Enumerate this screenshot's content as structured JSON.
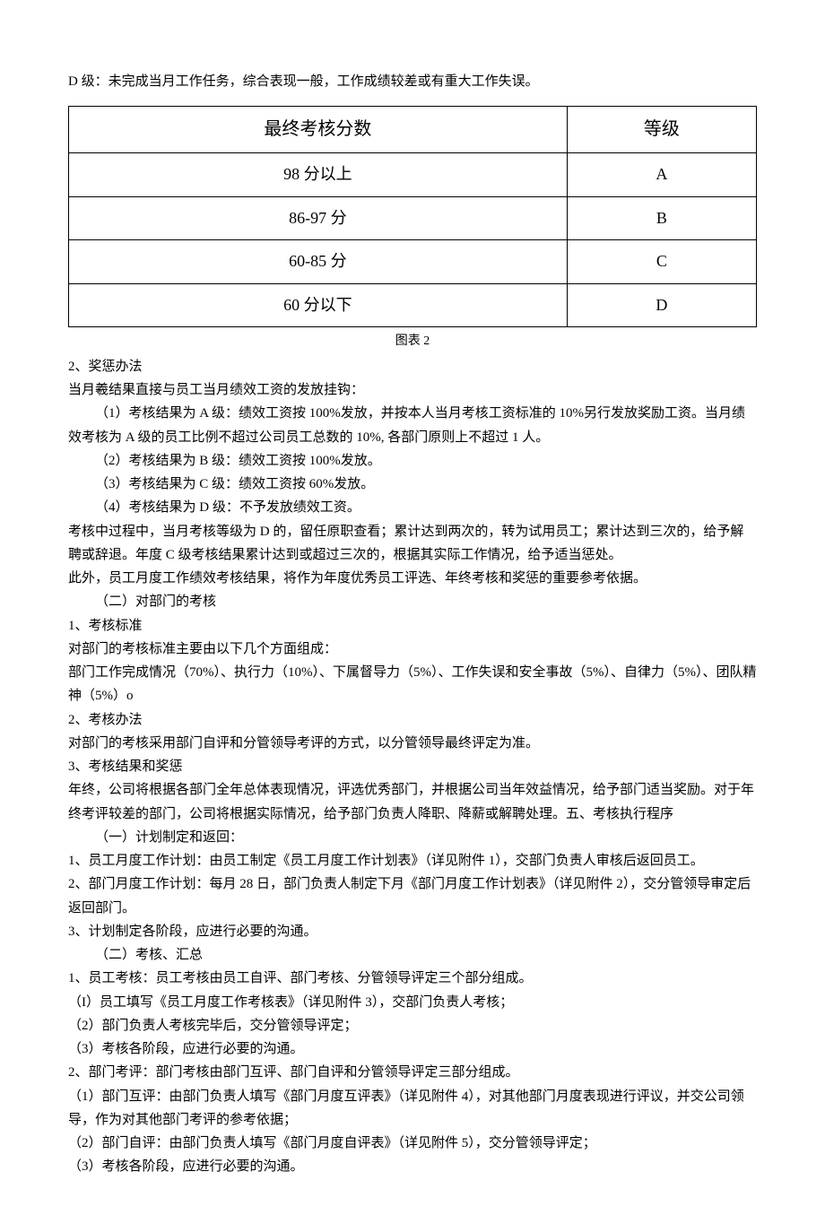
{
  "intro": "D 级：未完成当月工作任务，综合表现一般，工作成绩较差或有重大工作失误。",
  "table": {
    "header_score": "最终考核分数",
    "header_grade": "等级",
    "rows": [
      {
        "score": "98 分以上",
        "grade": "A"
      },
      {
        "score": "86-97 分",
        "grade": "B"
      },
      {
        "score": "60-85 分",
        "grade": "C"
      },
      {
        "score": "60 分以下",
        "grade": "D"
      }
    ],
    "caption": "图表 2"
  },
  "s1": {
    "h": "2、奖惩办法",
    "p0": "当月羲结果直接与员工当月绩效工资的发放挂钩：",
    "p1": "（1）考核结果为 A 级：绩效工资按 100%发放，并按本人当月考核工资标准的 10%另行发放奖励工资。当月绩效考核为 A 级的员工比例不超过公司员工总数的 10%, 各部门原则上不超过 1 人。",
    "p2": "（2）考核结果为 B 级：绩效工资按 100%发放。",
    "p3": "（3）考核结果为 C 级：绩效工资按 60%发放。",
    "p4": "（4）考核结果为 D 级：不予发放绩效工资。",
    "p5": "考核中过程中，当月考核等级为 D 的，留任原职查看；累计达到两次的，转为试用员工；累计达到三次的，给予解聘或辞退。年度 C 级考核结果累计达到或超过三次的，根据其实际工作情况，给予适当惩处。",
    "p6": "此外，员工月度工作绩效考核结果，将作为年度优秀员工评选、年终考核和奖惩的重要参考依据。"
  },
  "s2": {
    "h0": "（二）对部门的考核",
    "h1": "1、考核标准",
    "p1": "对部门的考核标准主要由以下几个方面组成：",
    "p2": "部门工作完成情况（70%）、执行力（10%）、下属督导力（5%）、工作失误和安全事故（5%）、自律力（5%）、团队精神（5%）o",
    "h2": "2、考核办法",
    "p3": "对部门的考核采用部门自评和分管领导考评的方式，以分管领导最终评定为准。",
    "h3": "3、考核结果和奖惩",
    "p4": "年终，公司将根据各部门全年总体表现情况，评选优秀部门，并根据公司当年效益情况，给予部门适当奖励。对于年终考评较差的部门，公司将根据实际情况，给予部门负责人降职、降薪或解聘处理。五、考核执行程序"
  },
  "s3": {
    "h0": "（一）计划制定和返回：",
    "p1": "1、员工月度工作计划：由员工制定《员工月度工作计划表》（详见附件 1），交部门负责人审核后返回员工。",
    "p2": "2、部门月度工作计划：每月 28 日，部门负责人制定下月《部门月度工作计划表》（详见附件 2），交分管领导审定后返回部门。",
    "p3": "3、计划制定各阶段，应进行必要的沟通。"
  },
  "s4": {
    "h0": "（二）考核、汇总",
    "p1": "1、员工考核：员工考核由员工自评、部门考核、分管领导评定三个部分组成。",
    "p2": "（I）员工填写《员工月度工作考核表》（详见附件 3），交部门负责人考核；",
    "p3": "（2）部门负责人考核完毕后，交分管领导评定；",
    "p4": "（3）考核各阶段，应进行必要的沟通。",
    "p5": "2、部门考评：部门考核由部门互评、部门自评和分管领导评定三部分组成。",
    "p6": "（1）部门互评：由部门负责人填写《部门月度互评表》（详见附件 4），对其他部门月度表现进行评议，并交公司领导，作为对其他部门考评的参考依据；",
    "p7": "（2）部门自评：由部门负责人填写《部门月度自评表》（详见附件 5），交分管领导评定；",
    "p8": "（3）考核各阶段，应进行必要的沟通。"
  }
}
